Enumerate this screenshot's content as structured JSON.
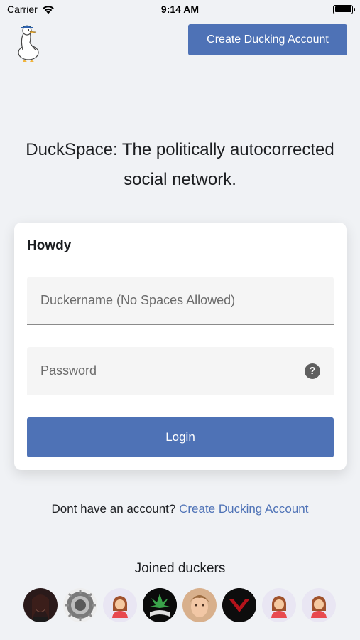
{
  "status_bar": {
    "carrier": "Carrier",
    "time": "9:14 AM"
  },
  "header": {
    "create_account_label": "Create Ducking Account"
  },
  "tagline": "DuckSpace: The politically autocorrected social network.",
  "login_card": {
    "title": "Howdy",
    "username_placeholder": "Duckername (No Spaces Allowed)",
    "password_placeholder": "Password",
    "help_glyph": "?",
    "login_label": "Login"
  },
  "signup": {
    "prompt": "Dont have an account? ",
    "link_label": "Create Ducking Account"
  },
  "joined": {
    "title": "Joined duckers",
    "avatars": [
      {
        "kind": "photo-dark-portrait"
      },
      {
        "kind": "gear-emblem"
      },
      {
        "kind": "default-woman-icon"
      },
      {
        "kind": "leaf-graphic"
      },
      {
        "kind": "photo-face"
      },
      {
        "kind": "red-chevron-logo"
      },
      {
        "kind": "default-woman-icon"
      },
      {
        "kind": "default-woman-icon"
      }
    ]
  },
  "colors": {
    "accent": "#4e72b6",
    "background": "#f0f2f5",
    "card": "#ffffff"
  }
}
